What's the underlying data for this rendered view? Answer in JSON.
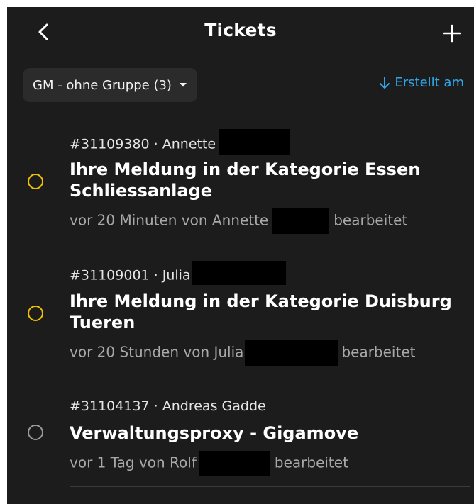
{
  "header": {
    "title": "Tickets"
  },
  "filters": {
    "group_label": "GM - ohne Gruppe (3)",
    "sort_label": "Erstellt am"
  },
  "tickets": [
    {
      "meta": "#31109380 · Annette",
      "subject": "Ihre Meldung in der Kategorie Essen Schliessanlage",
      "updated_prefix": "vor 20 Minuten von Annette",
      "updated_suffix": "bearbeitet",
      "status_color": "#f2c200"
    },
    {
      "meta": "#31109001 · Julia",
      "subject": "Ihre Meldung in der Kategorie Duisburg Tueren",
      "updated_prefix": "vor 20 Stunden von Julia",
      "updated_suffix": "bearbeitet",
      "status_color": "#f2c200"
    },
    {
      "meta": "#31104137 · Andreas Gadde",
      "subject": "Verwaltungsproxy - Gigamove",
      "updated_prefix": "vor 1 Tag von Rolf",
      "updated_suffix": "bearbeitet",
      "status_color": "#9a9a9a"
    }
  ]
}
